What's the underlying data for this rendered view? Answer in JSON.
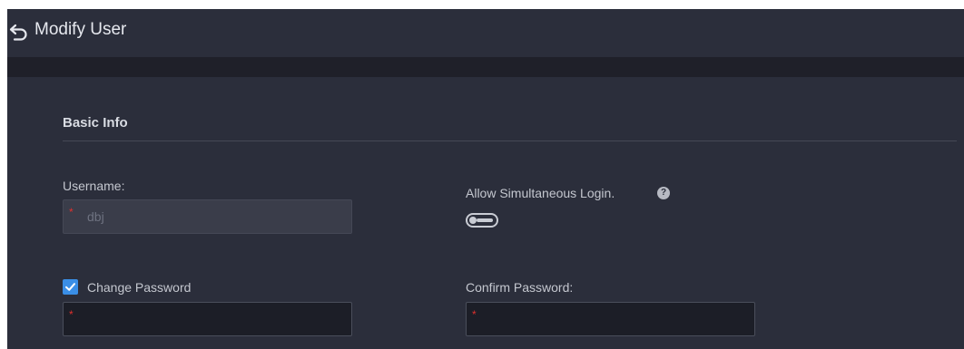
{
  "header": {
    "title": "Modify User",
    "back_icon": "undo-arrow-icon"
  },
  "section": {
    "title": "Basic Info"
  },
  "form": {
    "username": {
      "label": "Username:",
      "value": "dbj",
      "required_mark": "*",
      "disabled": true
    },
    "simultaneous_login": {
      "label": "Allow Simultaneous Login.",
      "help_icon": "question-circle-icon",
      "help_glyph": "?",
      "enabled": false
    },
    "change_password": {
      "label": "Change Password",
      "checked": true,
      "required_mark": "*",
      "value": ""
    },
    "confirm_password": {
      "label": "Confirm Password:",
      "required_mark": "*",
      "value": ""
    }
  },
  "colors": {
    "background": "#2b2e3b",
    "accent": "#3a8ee6",
    "required": "#e0302d"
  }
}
